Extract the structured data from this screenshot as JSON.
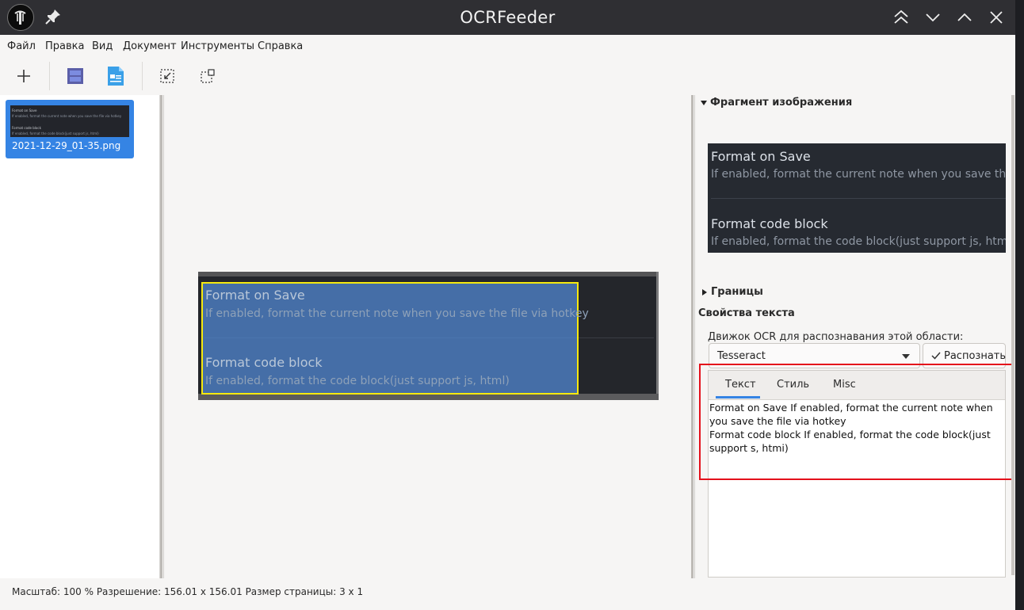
{
  "window": {
    "title": "OCRFeeder"
  },
  "menu": {
    "items": [
      "Файл",
      "Правка",
      "Вид",
      "Документ",
      "Инструменты",
      "Справка"
    ]
  },
  "toolbar": {
    "buttons": [
      "add-icon",
      "page-layout-icon",
      "document-text-icon",
      "zoom-fit-icon",
      "select-area-icon"
    ]
  },
  "pages_panel": {
    "thumbnail_caption": "2021-12-29_01-35.png",
    "thumb_lines": [
      "Format on Save",
      "If enabled, format the current note when you save the file via hotkey",
      "Format code block",
      "If enabled, format the code block(just support js, html)"
    ]
  },
  "canvas": {
    "line1": "Format on Save",
    "line2": "If enabled, format the current note when you save the file via hotkey",
    "line3": "Format code block",
    "line4": "If enabled, format the code block(just support js, html)"
  },
  "properties": {
    "image_fragment_header": "Фрагмент изображения",
    "preview": {
      "line1": "Format on Save",
      "line2": "If enabled, format the current note when you save the file via hotkey",
      "line3": "Format code block",
      "line4": "If enabled, format the code block(just support js, html)"
    },
    "bounds_header": "Границы",
    "text_props_header": "Свойства текста",
    "ocr_engine_label": "Движок OCR для распознавания этой области:",
    "ocr_engine_value": "Tesseract",
    "recognize_button": "Распознать",
    "tabs": [
      "Текст",
      "Стиль",
      "Misc"
    ],
    "active_tab": "Текст",
    "ocr_result": "Format on Save If enabled, format the current note when you save the file via hotkey\nFormat code block If enabled, format the code block(just support s, htmi)"
  },
  "status": {
    "text": "Масштаб: 100 % Разрешение: 156.01 x 156.01 Размер страницы: 3 x 1"
  },
  "colors": {
    "titlebar": "#2f2f33",
    "accent": "#3584e4",
    "selection_border": "#f6e90e",
    "highlight_box": "#e4101b"
  }
}
